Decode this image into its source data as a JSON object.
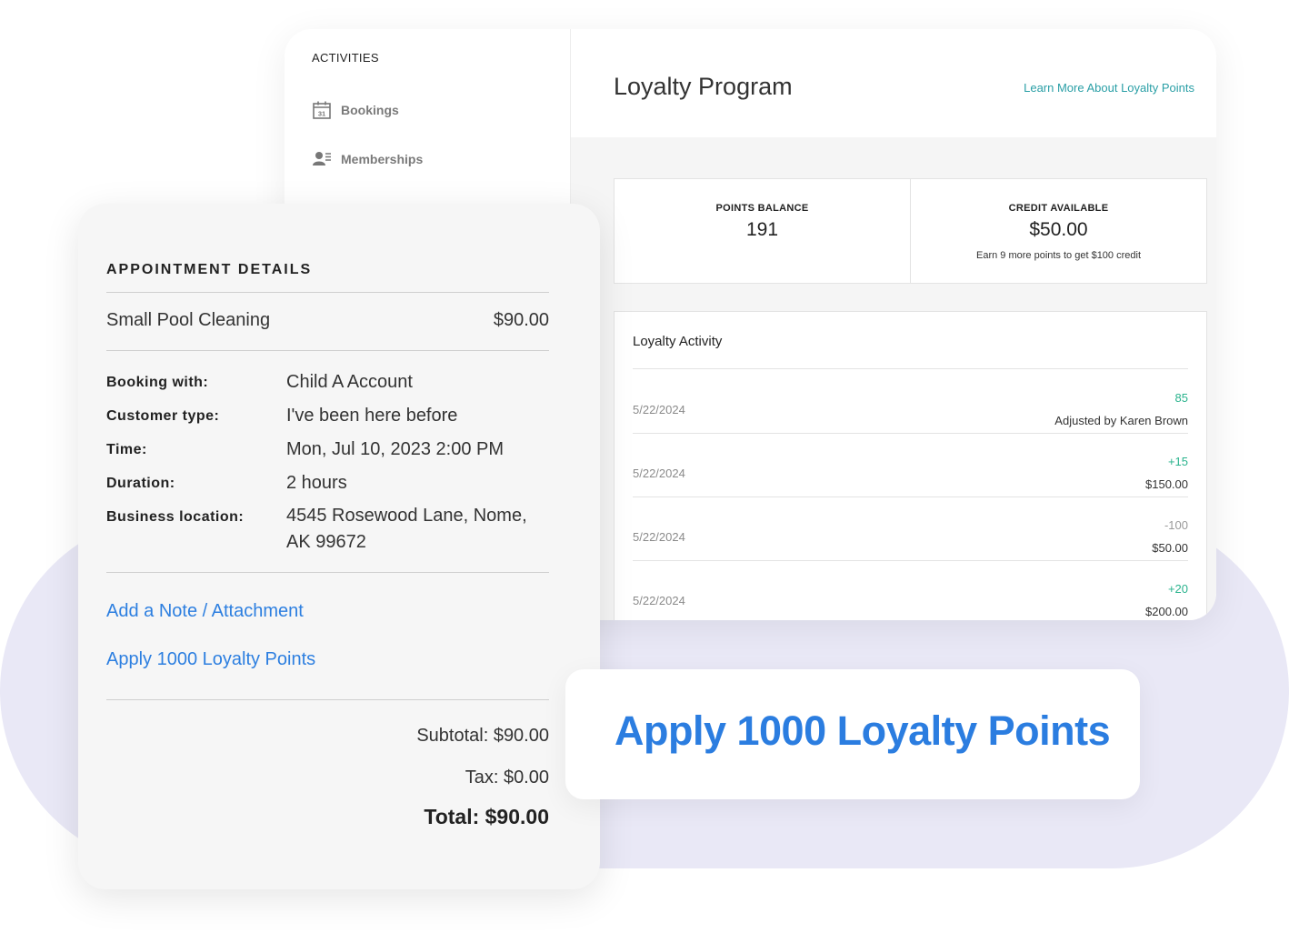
{
  "sidebar": {
    "heading": "ACTIVITIES",
    "items": [
      {
        "label": "Bookings",
        "icon": "calendar-icon"
      },
      {
        "label": "Memberships",
        "icon": "membership-icon"
      }
    ]
  },
  "loyalty": {
    "title": "Loyalty Program",
    "learn_more": "Learn More About Loyalty Points",
    "points_balance_label": "POINTS BALANCE",
    "points_balance": "191",
    "credit_label": "CREDIT AVAILABLE",
    "credit": "$50.00",
    "credit_note": "Earn 9 more points to get $100 credit",
    "activity_title": "Loyalty Activity",
    "activity": [
      {
        "date": "5/22/2024",
        "points": "85",
        "desc": "Adjusted by Karen Brown"
      },
      {
        "date": "5/22/2024",
        "points": "+15",
        "desc": "$150.00"
      },
      {
        "date": "5/22/2024",
        "points": "-100",
        "desc": "$50.00"
      },
      {
        "date": "5/22/2024",
        "points": "+20",
        "desc": "$200.00"
      }
    ]
  },
  "appointment": {
    "heading": "APPOINTMENT DETAILS",
    "service": "Small Pool Cleaning",
    "price": "$90.00",
    "details": [
      {
        "label": "Booking with:",
        "value": "Child A Account"
      },
      {
        "label": "Customer type:",
        "value": "I've been here before"
      },
      {
        "label": "Time:",
        "value": "Mon, Jul 10, 2023 2:00 PM"
      },
      {
        "label": "Duration:",
        "value": "2 hours"
      },
      {
        "label": "Business location:",
        "value": "4545 Rosewood Lane, Nome, AK 99672"
      }
    ],
    "add_note": "Add a Note / Attachment",
    "apply_points": "Apply 1000 Loyalty Points",
    "subtotal": "Subtotal: $90.00",
    "tax": "Tax: $0.00",
    "total": "Total: $90.00"
  },
  "callout": {
    "text": "Apply 1000 Loyalty Points"
  },
  "colors": {
    "accent_blue": "#2b7de0",
    "teal_link": "#2a9fa6",
    "positive_green": "#2ab38d",
    "blob_lavender": "#e9e8f6"
  }
}
